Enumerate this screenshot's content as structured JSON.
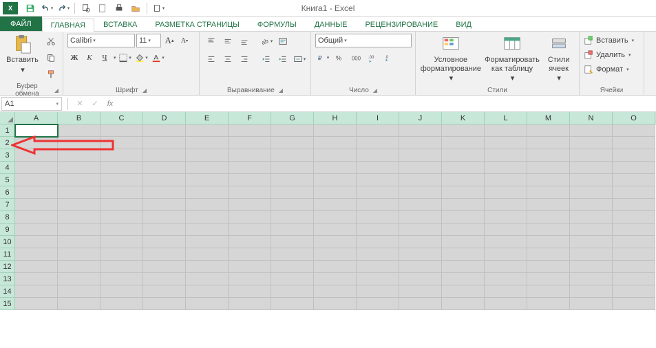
{
  "app": {
    "title": "Книга1 - Excel",
    "icon_label": "X"
  },
  "qat": {
    "save": "save",
    "undo": "undo",
    "redo": "redo",
    "preview": "print-preview",
    "new": "new",
    "quickprint": "quick-print",
    "open": "open",
    "spell": "spellcheck"
  },
  "tabs": {
    "file": "ФАЙЛ",
    "items": [
      "ГЛАВНАЯ",
      "ВСТАВКА",
      "РАЗМЕТКА СТРАНИЦЫ",
      "ФОРМУЛЫ",
      "ДАННЫЕ",
      "РЕЦЕНЗИРОВАНИЕ",
      "ВИД"
    ],
    "active_index": 0
  },
  "ribbon": {
    "clipboard": {
      "paste": "Вставить",
      "label": "Буфер обмена"
    },
    "font": {
      "name": "Calibri",
      "size": "11",
      "label": "Шрифт",
      "bold": "Ж",
      "italic": "К",
      "underline": "Ч"
    },
    "alignment": {
      "label": "Выравнивание"
    },
    "number": {
      "format": "Общий",
      "label": "Число"
    },
    "styles": {
      "cond": "Условное форматирование",
      "table": "Форматировать как таблицу",
      "cell": "Стили ячеек",
      "label": "Стили"
    },
    "cells": {
      "insert": "Вставить",
      "delete": "Удалить",
      "format": "Формат",
      "label": "Ячейки"
    }
  },
  "formula": {
    "name_box": "A1"
  },
  "grid": {
    "columns": [
      "A",
      "B",
      "C",
      "D",
      "E",
      "F",
      "G",
      "H",
      "I",
      "J",
      "K",
      "L",
      "M",
      "N",
      "O"
    ],
    "rows": [
      1,
      2,
      3,
      4,
      5,
      6,
      7,
      8,
      9,
      10,
      11,
      12,
      13,
      14,
      15
    ],
    "active": {
      "row": 1,
      "col": "A"
    }
  }
}
